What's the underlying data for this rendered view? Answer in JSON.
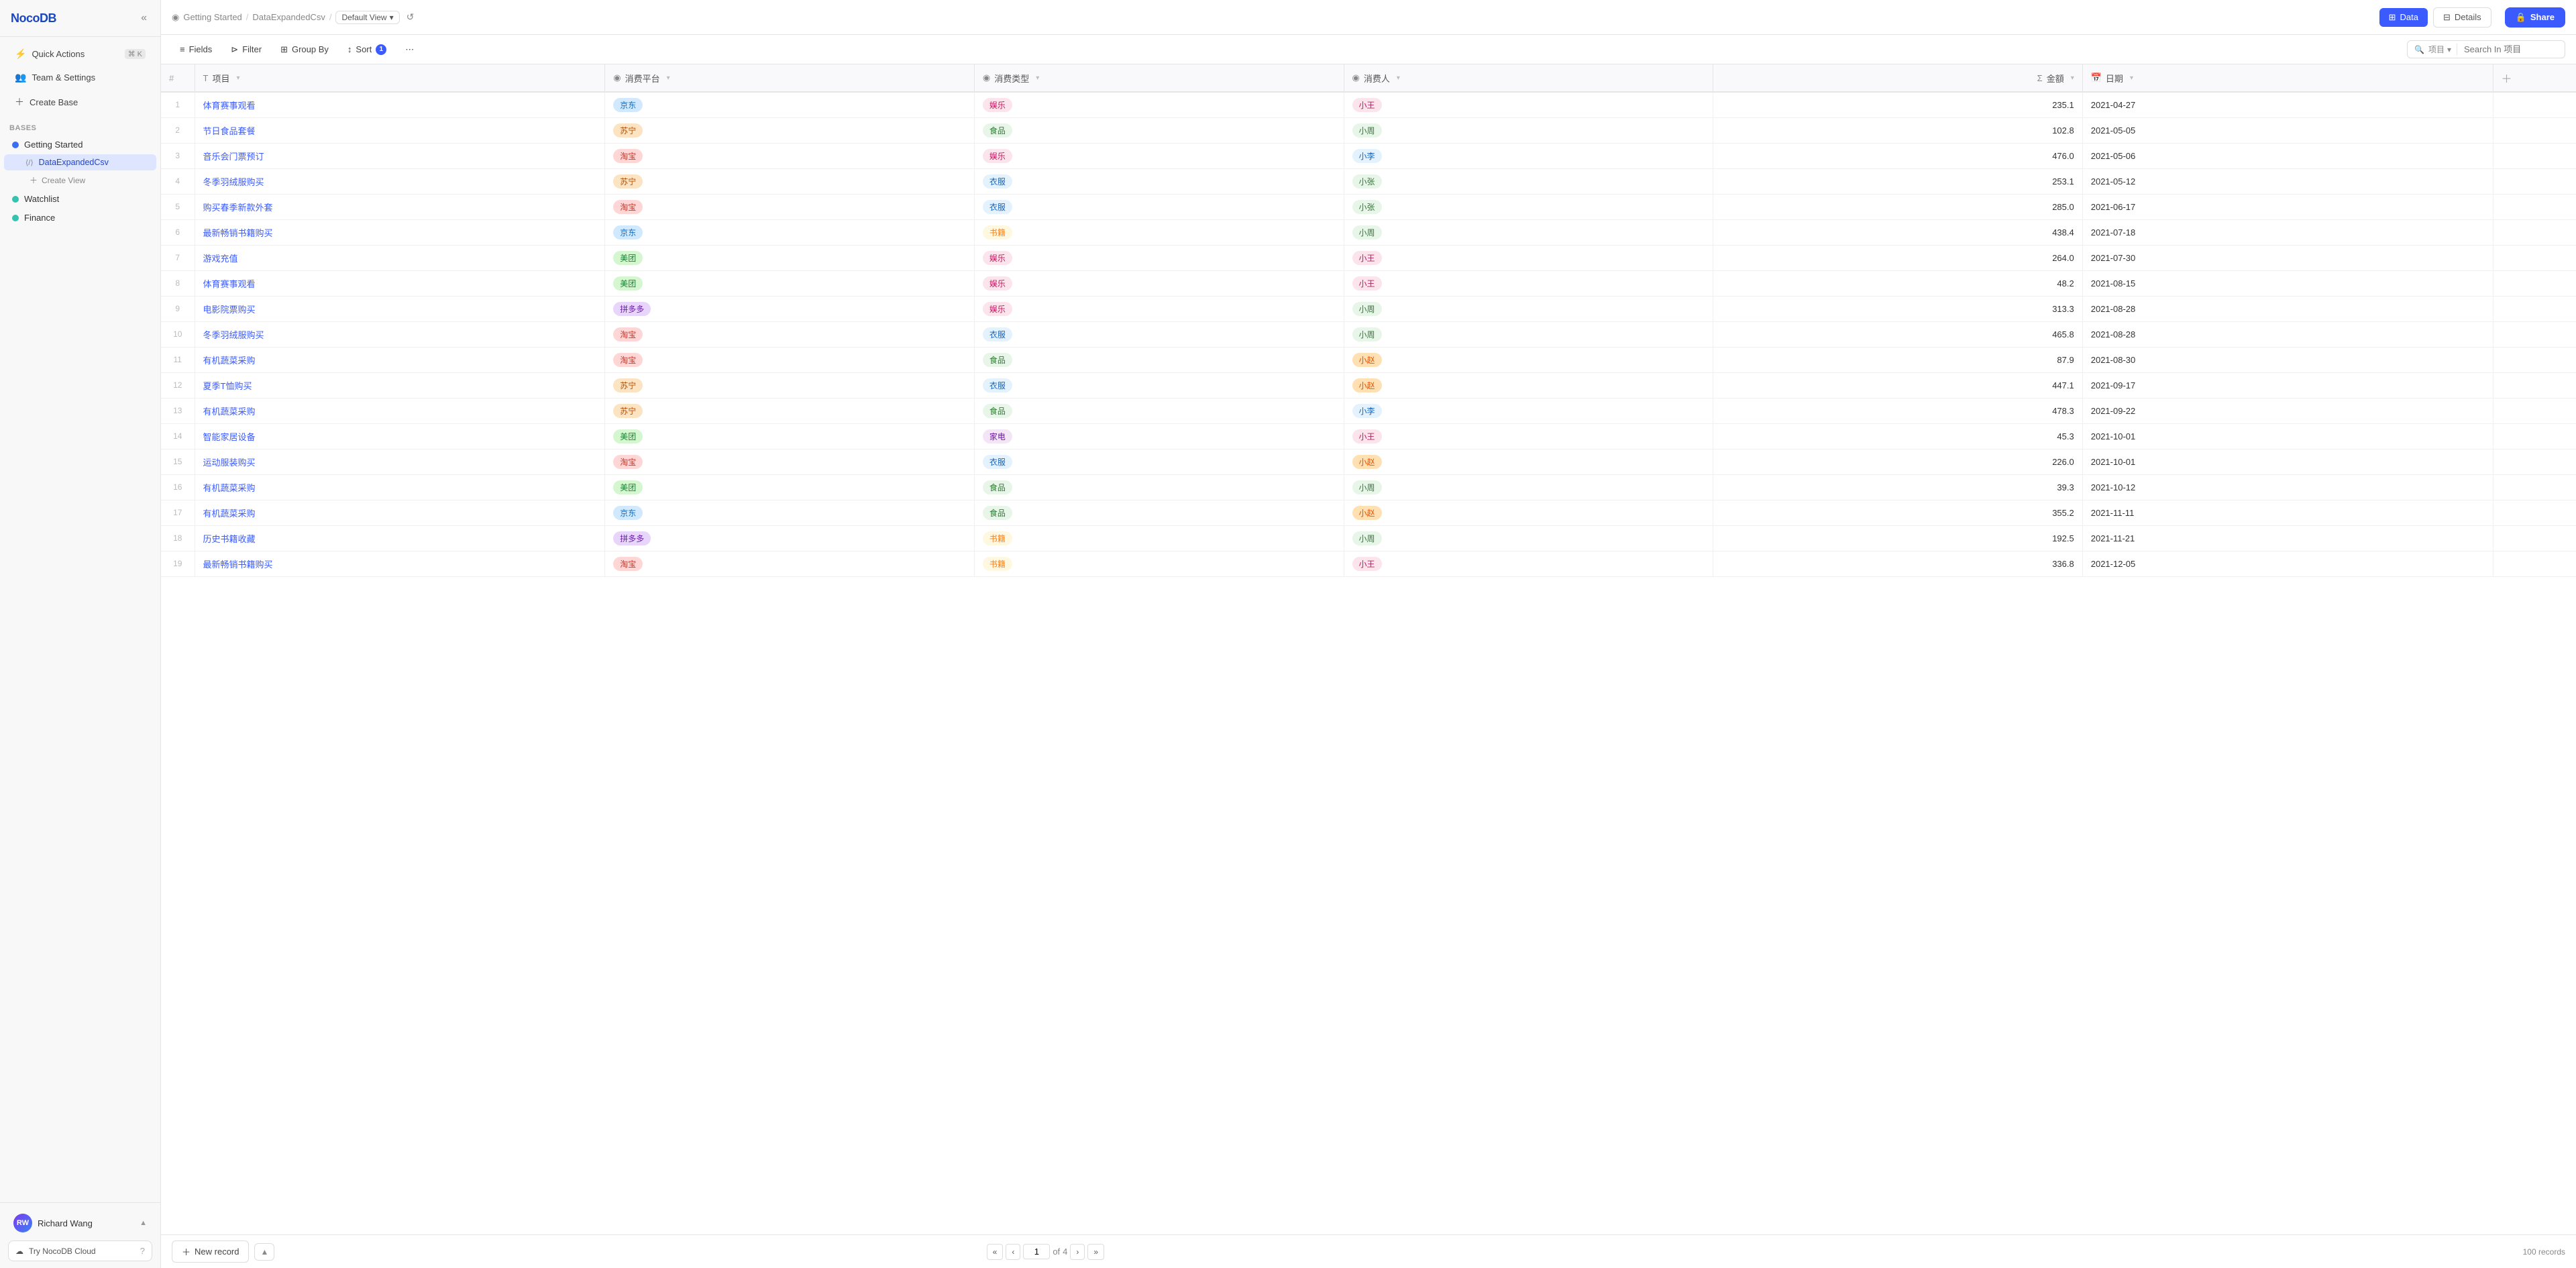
{
  "app": {
    "logo": "NocoDB",
    "collapse_label": "«"
  },
  "sidebar": {
    "quick_actions_label": "Quick Actions",
    "quick_actions_kbd": "⌘ K",
    "team_settings_label": "Team & Settings",
    "create_base_label": "Create Base",
    "bases_label": "Bases",
    "bases": [
      {
        "id": "getting-started",
        "label": "Getting Started",
        "dot_color": "blue",
        "active": true,
        "tables": [
          {
            "id": "data-expanded-csv",
            "label": "DataExpandedCsv",
            "active": true
          }
        ]
      },
      {
        "id": "watchlist",
        "label": "Watchlist",
        "dot_color": "teal",
        "active": false
      },
      {
        "id": "finance",
        "label": "Finance",
        "dot_color": "teal",
        "active": false
      }
    ],
    "create_view_label": "Create View",
    "user": {
      "initials": "RW",
      "name": "Richard Wang",
      "chevron": "▲"
    },
    "try_cloud_label": "Try NocoDB Cloud",
    "try_cloud_icon": "?"
  },
  "breadcrumb": {
    "base": "Getting Started",
    "table": "DataExpandedCsv",
    "view": "Default View"
  },
  "toolbar": {
    "fields_label": "Fields",
    "filter_label": "Filter",
    "group_by_label": "Group By",
    "sort_label": "Sort",
    "sort_count": "1",
    "more_btn_label": "⋯",
    "search_field_label": "项目",
    "search_placeholder": "Search In 项目"
  },
  "topbar": {
    "data_label": "Data",
    "details_label": "Details",
    "share_label": "Share"
  },
  "table": {
    "columns": [
      {
        "id": "row-num",
        "label": "#",
        "icon": ""
      },
      {
        "id": "xiang-mu",
        "label": "项目",
        "icon": "T"
      },
      {
        "id": "xiao-fei-ping-tai",
        "label": "消费平台",
        "icon": "◉"
      },
      {
        "id": "xiao-fei-lei-xing",
        "label": "消费类型",
        "icon": "◉"
      },
      {
        "id": "xiao-fei-ren",
        "label": "消费人",
        "icon": "◉"
      },
      {
        "id": "jin-e",
        "label": "金額",
        "icon": "Σ"
      },
      {
        "id": "ri-qi",
        "label": "日期",
        "icon": "📅"
      }
    ],
    "rows": [
      {
        "id": 1,
        "name": "体育赛事观看",
        "platform": "京东",
        "platform_type": "jd",
        "type": "娱乐",
        "type_key": "entertainment",
        "person": "小王",
        "person_key": "wang",
        "amount": "235.1",
        "date": "2021-04-27"
      },
      {
        "id": 2,
        "name": "节日食品套餐",
        "platform": "苏宁",
        "platform_type": "suning",
        "type": "食品",
        "type_key": "food",
        "person": "小周",
        "person_key": "zhou",
        "amount": "102.8",
        "date": "2021-05-05"
      },
      {
        "id": 3,
        "name": "音乐会门票预订",
        "platform": "淘宝",
        "platform_type": "taobao",
        "type": "娱乐",
        "type_key": "entertainment",
        "person": "小李",
        "person_key": "li",
        "amount": "476.0",
        "date": "2021-05-06"
      },
      {
        "id": 4,
        "name": "冬季羽绒服购买",
        "platform": "苏宁",
        "platform_type": "suning",
        "type": "衣服",
        "type_key": "clothes",
        "person": "小张",
        "person_key": "zhang",
        "amount": "253.1",
        "date": "2021-05-12"
      },
      {
        "id": 5,
        "name": "购买春季新款外套",
        "platform": "淘宝",
        "platform_type": "taobao",
        "type": "衣服",
        "type_key": "clothes",
        "person": "小张",
        "person_key": "zhang",
        "amount": "285.0",
        "date": "2021-06-17"
      },
      {
        "id": 6,
        "name": "最新畅销书籍购买",
        "platform": "京东",
        "platform_type": "jd",
        "type": "书籍",
        "type_key": "books",
        "person": "小周",
        "person_key": "zhou",
        "amount": "438.4",
        "date": "2021-07-18"
      },
      {
        "id": 7,
        "name": "游戏充值",
        "platform": "美团",
        "platform_type": "meituan",
        "type": "娱乐",
        "type_key": "entertainment",
        "person": "小王",
        "person_key": "wang",
        "amount": "264.0",
        "date": "2021-07-30"
      },
      {
        "id": 8,
        "name": "体育赛事观看",
        "platform": "美团",
        "platform_type": "meituan",
        "type": "娱乐",
        "type_key": "entertainment",
        "person": "小王",
        "person_key": "wang",
        "amount": "48.2",
        "date": "2021-08-15"
      },
      {
        "id": 9,
        "name": "电影院票购买",
        "platform": "拼多多",
        "platform_type": "pinduoduo",
        "type": "娱乐",
        "type_key": "entertainment",
        "person": "小周",
        "person_key": "zhou",
        "amount": "313.3",
        "date": "2021-08-28"
      },
      {
        "id": 10,
        "name": "冬季羽绒服购买",
        "platform": "淘宝",
        "platform_type": "taobao",
        "type": "衣服",
        "type_key": "clothes",
        "person": "小周",
        "person_key": "zhou",
        "amount": "465.8",
        "date": "2021-08-28"
      },
      {
        "id": 11,
        "name": "有机蔬菜采购",
        "platform": "淘宝",
        "platform_type": "taobao",
        "type": "食品",
        "type_key": "food",
        "person": "小赵",
        "person_key": "zhao",
        "amount": "87.9",
        "date": "2021-08-30"
      },
      {
        "id": 12,
        "name": "夏季T恤购买",
        "platform": "苏宁",
        "platform_type": "suning",
        "type": "衣服",
        "type_key": "clothes",
        "person": "小赵",
        "person_key": "zhao",
        "amount": "447.1",
        "date": "2021-09-17"
      },
      {
        "id": 13,
        "name": "有机蔬菜采购",
        "platform": "苏宁",
        "platform_type": "suning",
        "type": "食品",
        "type_key": "food",
        "person": "小李",
        "person_key": "li",
        "amount": "478.3",
        "date": "2021-09-22"
      },
      {
        "id": 14,
        "name": "智能家居设备",
        "platform": "美团",
        "platform_type": "meituan",
        "type": "家电",
        "type_key": "electronics",
        "person": "小王",
        "person_key": "wang",
        "amount": "45.3",
        "date": "2021-10-01"
      },
      {
        "id": 15,
        "name": "运动服装购买",
        "platform": "淘宝",
        "platform_type": "taobao",
        "type": "衣服",
        "type_key": "clothes",
        "person": "小赵",
        "person_key": "zhao",
        "amount": "226.0",
        "date": "2021-10-01"
      },
      {
        "id": 16,
        "name": "有机蔬菜采购",
        "platform": "美团",
        "platform_type": "meituan",
        "type": "食品",
        "type_key": "food",
        "person": "小周",
        "person_key": "zhou",
        "amount": "39.3",
        "date": "2021-10-12"
      },
      {
        "id": 17,
        "name": "有机蔬菜采购",
        "platform": "京东",
        "platform_type": "jd",
        "type": "食品",
        "type_key": "food",
        "person": "小赵",
        "person_key": "zhao",
        "amount": "355.2",
        "date": "2021-11-11"
      },
      {
        "id": 18,
        "name": "历史书籍收藏",
        "platform": "拼多多",
        "platform_type": "pinduoduo",
        "type": "书籍",
        "type_key": "books",
        "person": "小周",
        "person_key": "zhou",
        "amount": "192.5",
        "date": "2021-11-21"
      },
      {
        "id": 19,
        "name": "最新畅销书籍购买",
        "platform": "淘宝",
        "platform_type": "taobao",
        "type": "书籍",
        "type_key": "books",
        "person": "小王",
        "person_key": "wang",
        "amount": "336.8",
        "date": "2021-12-05"
      }
    ]
  },
  "pagination": {
    "current_page": "1",
    "total_pages": "4",
    "of_label": "of",
    "total_records": "100 records",
    "new_record_label": "New record"
  }
}
